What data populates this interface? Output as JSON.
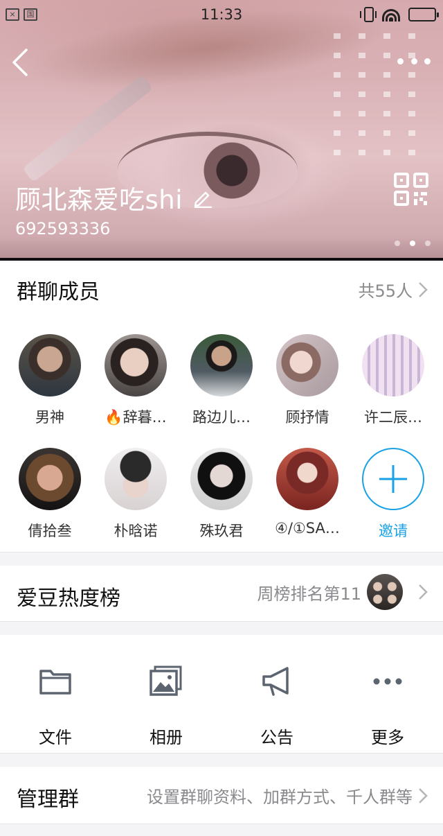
{
  "status_bar": {
    "sim_label": "国",
    "time": "11:33"
  },
  "header": {
    "group_name": "顾北森爱吃shi",
    "group_id": "692593336",
    "icons": [
      "back-icon",
      "more-icon",
      "edit-icon",
      "qr-code-icon"
    ]
  },
  "members": {
    "title": "群聊成员",
    "count_text": "共55人",
    "list": [
      {
        "name": "男神"
      },
      {
        "name": "🔥辞暮…"
      },
      {
        "name": "路边儿…"
      },
      {
        "name": "顾抒情"
      },
      {
        "name": "许二辰…"
      },
      {
        "name": "倩拾叁"
      },
      {
        "name": "朴晗诺"
      },
      {
        "name": "殊玖君"
      },
      {
        "name": "④/①SA…"
      }
    ],
    "invite_label": "邀请"
  },
  "idol_rank": {
    "title": "爱豆热度榜",
    "rank_text": "周榜排名第11"
  },
  "tools": [
    {
      "label": "文件",
      "icon": "folder-icon"
    },
    {
      "label": "相册",
      "icon": "album-icon"
    },
    {
      "label": "公告",
      "icon": "megaphone-icon"
    },
    {
      "label": "更多",
      "icon": "more-dots-icon"
    }
  ],
  "manage": {
    "title": "管理群",
    "hint": "设置群聊资料、加群方式、千人群等"
  },
  "colors": {
    "accent": "#19a2e3",
    "secondary_text": "#8a8a8e",
    "icon_gray": "#5c6470"
  }
}
